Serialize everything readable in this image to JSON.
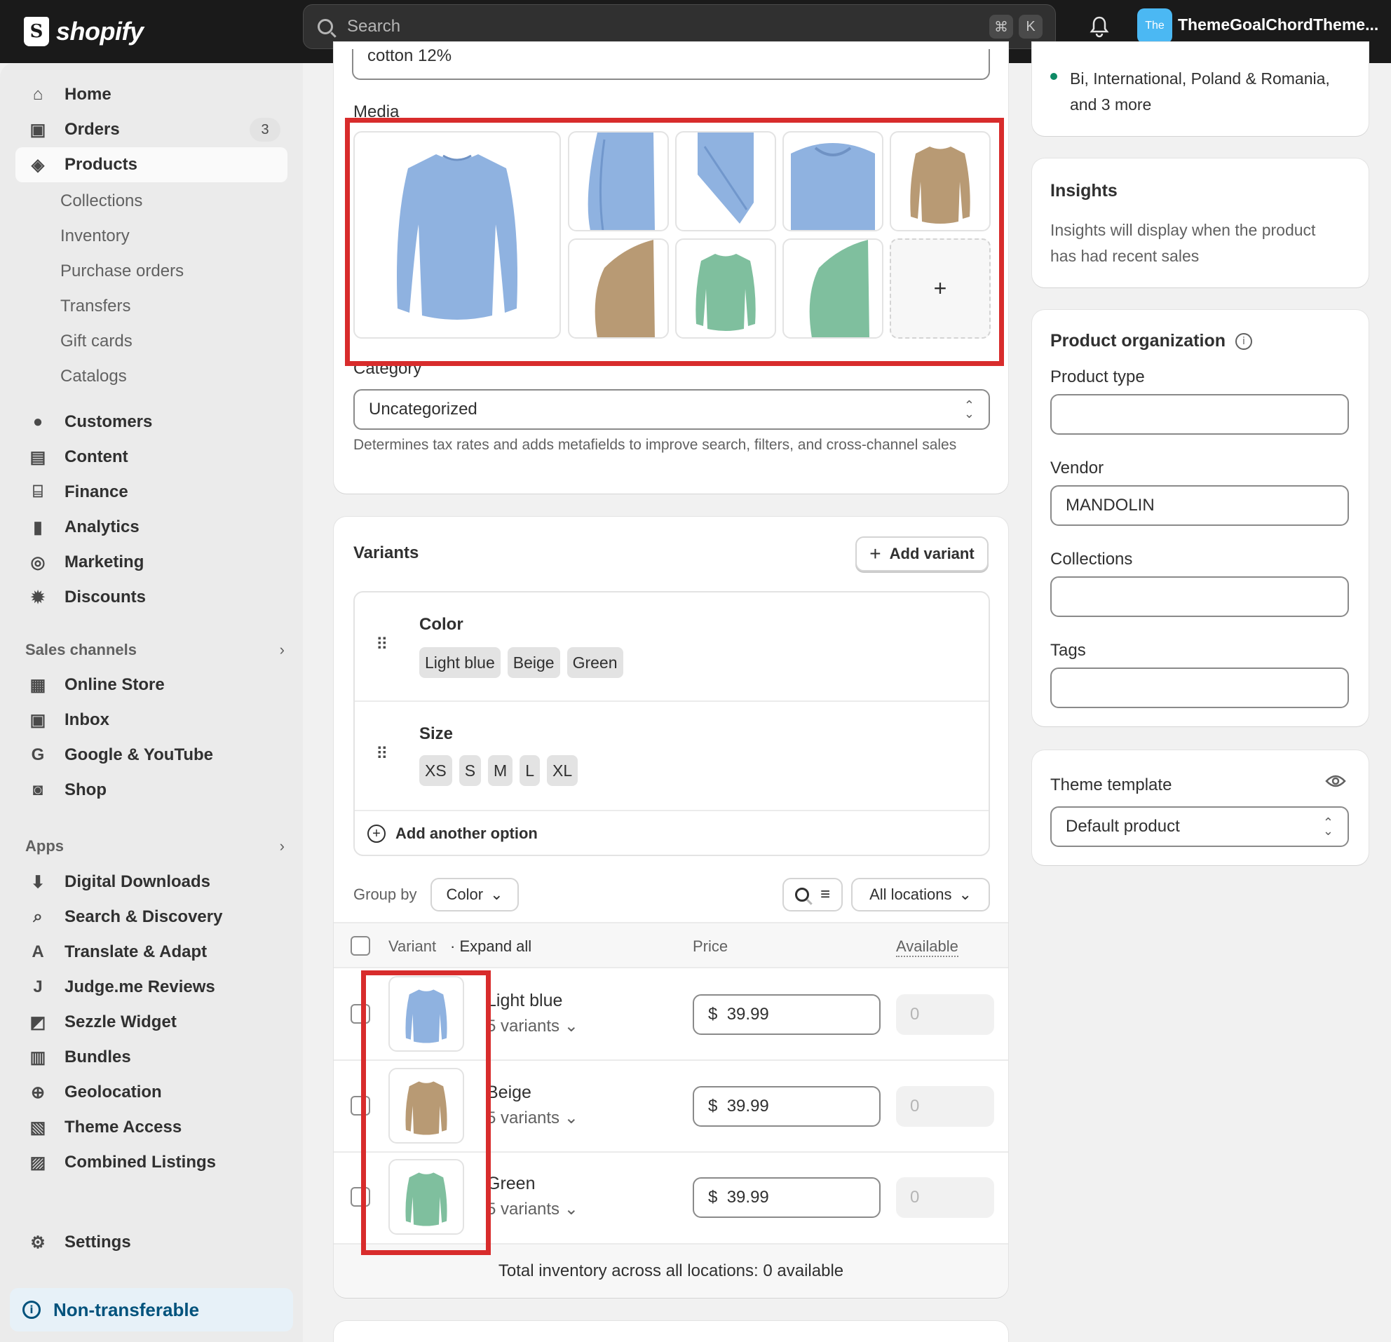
{
  "topbar": {
    "logo_text": "shopify",
    "search_placeholder": "Search",
    "kbd_cmd": "⌘",
    "kbd_k": "K",
    "store_initials": "The",
    "store_name": "ThemeGoalChordTheme..."
  },
  "sidebar": {
    "home": "Home",
    "orders": "Orders",
    "orders_count": "3",
    "products": "Products",
    "product_sub": [
      "Collections",
      "Inventory",
      "Purchase orders",
      "Transfers",
      "Gift cards",
      "Catalogs"
    ],
    "customers": "Customers",
    "content": "Content",
    "finance": "Finance",
    "analytics": "Analytics",
    "marketing": "Marketing",
    "discounts": "Discounts",
    "sales_channels_header": "Sales channels",
    "channels": [
      "Online Store",
      "Inbox",
      "Google & YouTube",
      "Shop"
    ],
    "apps_header": "Apps",
    "apps": [
      "Digital Downloads",
      "Search & Discovery",
      "Translate & Adapt",
      "Judge.me Reviews",
      "Sezzle Widget",
      "Bundles",
      "Geolocation",
      "Theme Access",
      "Combined Listings"
    ],
    "settings": "Settings",
    "footer": "Non-transferable"
  },
  "main": {
    "material_value": "cotton 12%",
    "media_label": "Media",
    "add_media": "+",
    "category_label": "Category",
    "category_value": "Uncategorized",
    "category_help": "Determines tax rates and adds metafields to improve search, filters, and cross-channel sales",
    "variants_title": "Variants",
    "add_variant": "Add variant",
    "option1_name": "Color",
    "option1_values": [
      "Light blue",
      "Beige",
      "Green"
    ],
    "option2_name": "Size",
    "option2_values": [
      "XS",
      "S",
      "M",
      "L",
      "XL"
    ],
    "add_option": "Add another option",
    "group_by_label": "Group by",
    "group_by_value": "Color",
    "locations_value": "All locations",
    "col_variant": "Variant",
    "col_expand": "· Expand all",
    "col_price": "Price",
    "col_available": "Available",
    "rows": [
      {
        "name": "Light blue",
        "count": "5 variants",
        "currency": "$",
        "price": "39.99",
        "available": "0"
      },
      {
        "name": "Beige",
        "count": "5 variants",
        "currency": "$",
        "price": "39.99",
        "available": "0"
      },
      {
        "name": "Green",
        "count": "5 variants",
        "currency": "$",
        "price": "39.99",
        "available": "0"
      }
    ],
    "total_inventory": "Total inventory across all locations: 0 available"
  },
  "right": {
    "markets_text": "Bi, International, Poland & Romania, and 3 more",
    "insights_title": "Insights",
    "insights_text": "Insights will display when the product has had recent sales",
    "org_title": "Product organization",
    "product_type_label": "Product type",
    "product_type_value": "",
    "vendor_label": "Vendor",
    "vendor_value": "MANDOLIN",
    "collections_label": "Collections",
    "tags_label": "Tags",
    "theme_label": "Theme template",
    "theme_value": "Default product"
  },
  "colors": {
    "light_blue": "#8fb2e0",
    "beige": "#b89a74",
    "green": "#7fbf9e",
    "highlight": "#d82c2c"
  }
}
